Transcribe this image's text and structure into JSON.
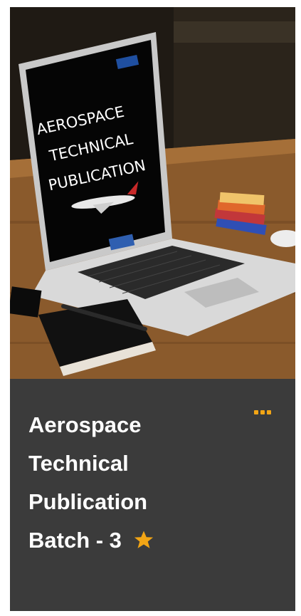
{
  "card": {
    "thumbnail": {
      "screen_text_lines": [
        "AEROSPACE",
        "TECHNICAL",
        "PUBLICATION"
      ]
    },
    "title_lines": [
      "Aerospace",
      "Technical",
      "Publication",
      "Batch - 3"
    ],
    "favorite": true,
    "more_menu_icon": "ellipsis-horizontal",
    "favorite_icon": "star"
  },
  "colors": {
    "card_background": "#3b3b3b",
    "title_text": "#ffffff",
    "accent": "#f2a515"
  }
}
